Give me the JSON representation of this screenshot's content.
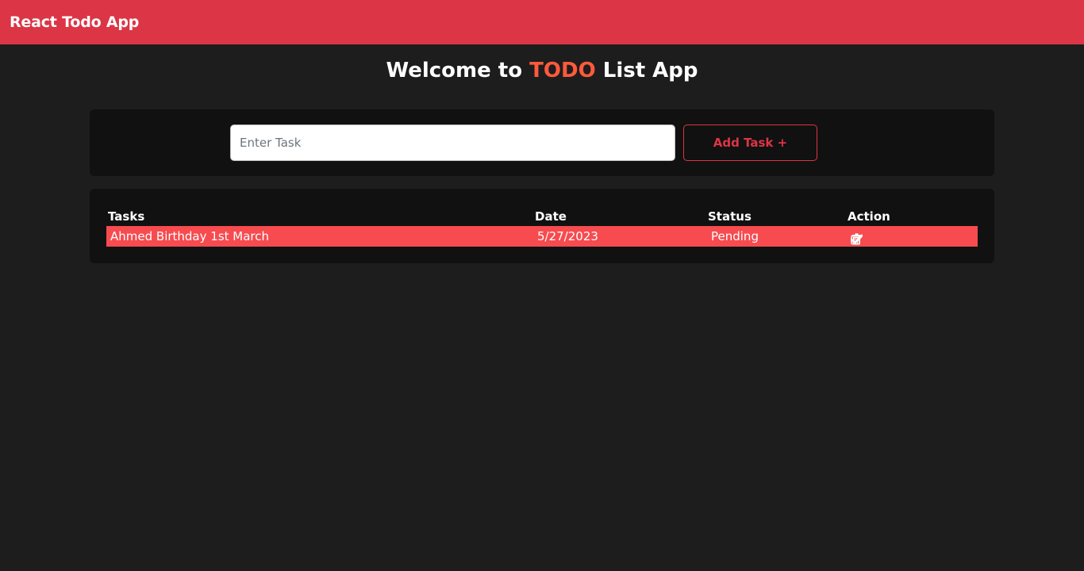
{
  "navbar": {
    "brand": "React Todo App"
  },
  "header": {
    "prefix": "Welcome to",
    "accent": "TODO",
    "suffix": "List App"
  },
  "input": {
    "placeholder": "Enter Task",
    "value": ""
  },
  "add_button": {
    "label": "Add Task +"
  },
  "table": {
    "columns": [
      "Tasks",
      "Date",
      "Status",
      "Action"
    ],
    "rows": [
      {
        "task": "Ahmed Birthday 1st March",
        "date": "5/27/2023",
        "status": "Pending",
        "actions": [
          "edit-icon",
          "trash-icon",
          "check-icon"
        ]
      }
    ]
  },
  "colors": {
    "navbar": "#dc3545",
    "background": "#1d1d1d",
    "card": "#111111",
    "accent_text": "#ff5a3c",
    "row_highlight": "#f74b4f"
  }
}
